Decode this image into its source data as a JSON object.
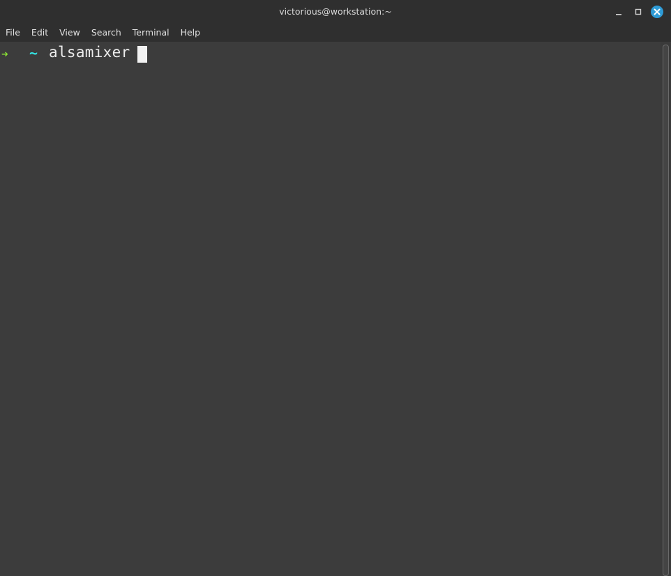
{
  "window": {
    "title": "victorious@workstation:~"
  },
  "menu": {
    "items": [
      {
        "label": "File"
      },
      {
        "label": "Edit"
      },
      {
        "label": "View"
      },
      {
        "label": "Search"
      },
      {
        "label": "Terminal"
      },
      {
        "label": "Help"
      }
    ]
  },
  "terminal": {
    "prompt_arrow": "➜",
    "prompt_dir": "~",
    "command": "alsamixer"
  },
  "colors": {
    "background": "#3c3c3c",
    "titlebar": "#2f2f2f",
    "prompt_arrow": "#8ae234",
    "prompt_dir": "#34e2e2",
    "close_button": "#2e9bd6"
  },
  "icons": {
    "minimize": "minimize-icon",
    "maximize": "maximize-icon",
    "close": "close-icon"
  }
}
